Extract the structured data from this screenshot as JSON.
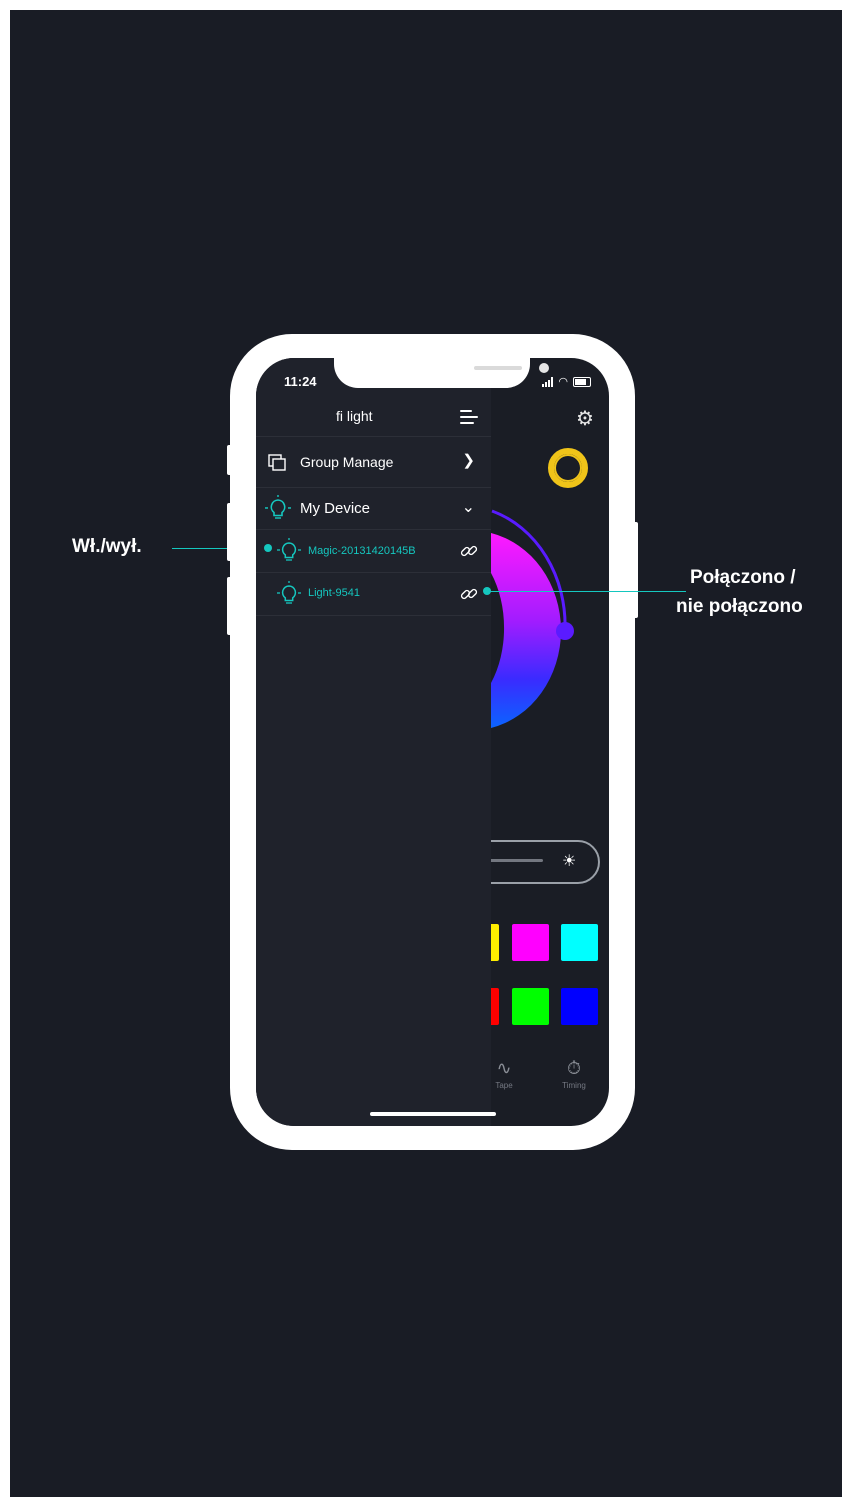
{
  "annotations": {
    "left_label": "Wł./wył.",
    "right_label_line1": "Połączono /",
    "right_label_line2": "nie połączono"
  },
  "status_bar": {
    "time": "11:24"
  },
  "drawer": {
    "title": "fi light",
    "group_manage": "Group Manage",
    "my_device": "My Device",
    "devices": [
      {
        "name": "Magic-20131420145B"
      },
      {
        "name": "Light-9541"
      }
    ]
  },
  "tabs": [
    {
      "label": "Tape",
      "icon": "tape-icon"
    },
    {
      "label": "Timing",
      "icon": "timer-icon"
    }
  ],
  "colors": {
    "background": "#191c25",
    "accent_teal": "#15c7bf",
    "ring_yellow": "#f0c419",
    "swatches": [
      "#ffee00",
      "#ff00ff",
      "#00ffff",
      "#ff0000",
      "#00ff00",
      "#0000ff"
    ]
  }
}
